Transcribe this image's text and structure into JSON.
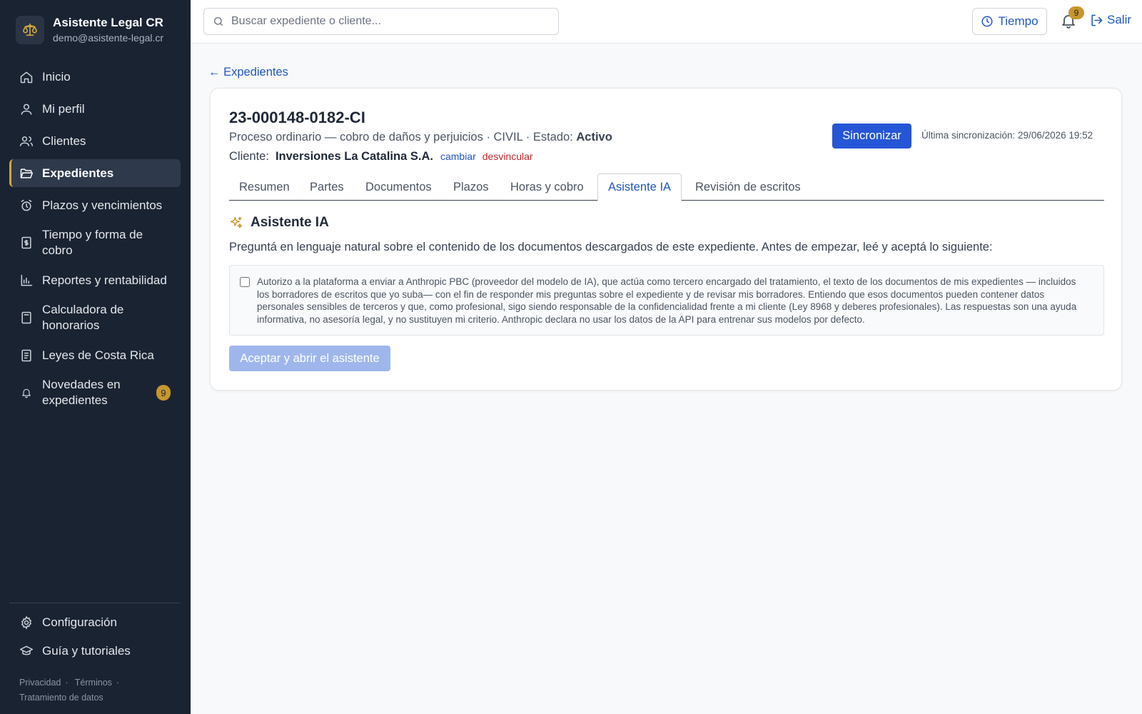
{
  "brand": {
    "title": "Asistente Legal CR",
    "email": "demo@asistente-legal.cr"
  },
  "sidebar": {
    "items": [
      {
        "label": "Inicio",
        "icon": "home-icon"
      },
      {
        "label": "Mi perfil",
        "icon": "user-icon"
      },
      {
        "label": "Clientes",
        "icon": "users-icon"
      },
      {
        "label": "Expedientes",
        "icon": "folder-open-icon",
        "active": true
      },
      {
        "label": "Plazos y vencimientos",
        "icon": "alarm-clock-icon"
      },
      {
        "label": "Tiempo y forma de cobro",
        "icon": "receipt-icon"
      },
      {
        "label": "Reportes y rentabilidad",
        "icon": "bar-chart-icon"
      },
      {
        "label": "Calculadora de honorarios",
        "icon": "calculator-icon"
      },
      {
        "label": "Leyes de Costa Rica",
        "icon": "book-icon"
      },
      {
        "label": "Novedades en expedientes",
        "icon": "bell-icon",
        "badge": "9"
      }
    ],
    "bottom": [
      {
        "label": "Configuración",
        "icon": "gear-icon"
      },
      {
        "label": "Guía y tutoriales",
        "icon": "graduation-cap-icon"
      }
    ],
    "legal": {
      "privacy": "Privacidad",
      "terms": "Términos",
      "data": "Tratamiento de datos",
      "sep": "·"
    }
  },
  "topbar": {
    "search_placeholder": "Buscar expediente o cliente...",
    "time_label": "Tiempo",
    "notifications_count": "9",
    "logout_label": "Salir"
  },
  "main": {
    "back_label": "← Expedientes",
    "case": {
      "number": "23-000148-0182-CI",
      "subtitle": "Proceso ordinario — cobro de daños y perjuicios · CIVIL · Estado:",
      "status": "Activo",
      "client_label": "Cliente:",
      "client_name": "Inversiones La Catalina S.A.",
      "change_label": "cambiar",
      "unlink_label": "desvincular",
      "sync_label": "Sincronizar",
      "last_sync": "Última sincronización: 29/06/2026 19:52"
    },
    "tabs": [
      {
        "label": "Resumen"
      },
      {
        "label": "Partes"
      },
      {
        "label": "Documentos"
      },
      {
        "label": "Plazos"
      },
      {
        "label": "Horas y cobro"
      },
      {
        "label": "Asistente IA",
        "active": true
      },
      {
        "label": "Revisión de escritos"
      }
    ],
    "assistant": {
      "title": "Asistente IA",
      "description": "Preguntá en lenguaje natural sobre el contenido de los documentos descargados de este expediente. Antes de empezar, leé y aceptá lo siguiente:",
      "consent_text": "Autorizo a la plataforma a enviar a Anthropic PBC (proveedor del modelo de IA), que actúa como tercero encargado del tratamiento, el texto de los documentos de mis expedientes — incluidos los borradores de escritos que yo suba— con el fin de responder mis preguntas sobre el expediente y de revisar mis borradores. Entiendo que esos documentos pueden contener datos personales sensibles de terceros y que, como profesional, sigo siendo responsable de la confidencialidad frente a mi cliente (Ley 8968 y deberes profesionales). Las respuestas son una ayuda informativa, no asesoría legal, y no sustituyen mi criterio. Anthropic declara no usar los datos de la API para entrenar sus modelos por defecto.",
      "consent_checked": false,
      "accept_label": "Aceptar y abrir el asistente"
    }
  },
  "colors": {
    "sidebar_bg": "#1a2332",
    "accent": "#2556d6",
    "gold": "#c7972d",
    "link": "#1f57c3",
    "danger": "#c0262d"
  }
}
